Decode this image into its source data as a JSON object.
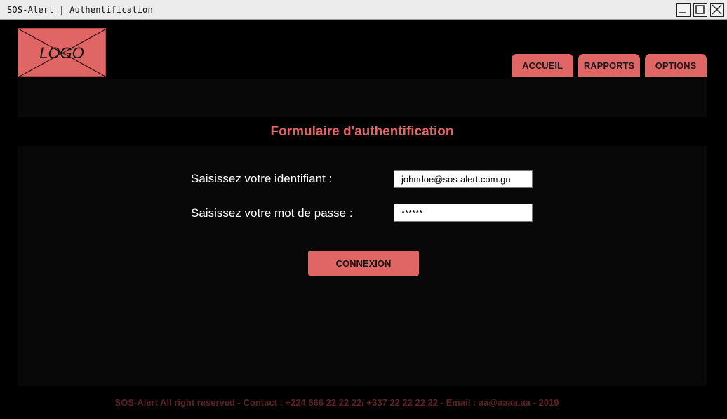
{
  "window": {
    "title": "SOS-Alert | Authentification"
  },
  "header": {
    "logo_text": "LOGO",
    "nav": [
      {
        "label": "ACCUEIL"
      },
      {
        "label": "RAPPORTS"
      },
      {
        "label": "OPTIONS"
      }
    ]
  },
  "form": {
    "title": "Formulaire d'authentification",
    "identifier_label": "Saisissez votre identifiant :",
    "identifier_value": "johndoe@sos-alert.com.gn",
    "password_label": "Saisissez votre mot de passe :",
    "password_value": "******",
    "submit_label": "CONNEXION"
  },
  "footer": {
    "text": "SOS-Alert All right reserved - Contact : +224 666 22 22 22/ +337 22 22 22 22 - Email : aa@aaaa.aa - 2019"
  },
  "colors": {
    "accent": "#e06666",
    "background": "#000000",
    "panel": "#080808",
    "footer_text": "#5a2324"
  },
  "icons": {
    "minimize": "minimize-icon",
    "maximize": "maximize-icon",
    "close": "close-icon"
  }
}
